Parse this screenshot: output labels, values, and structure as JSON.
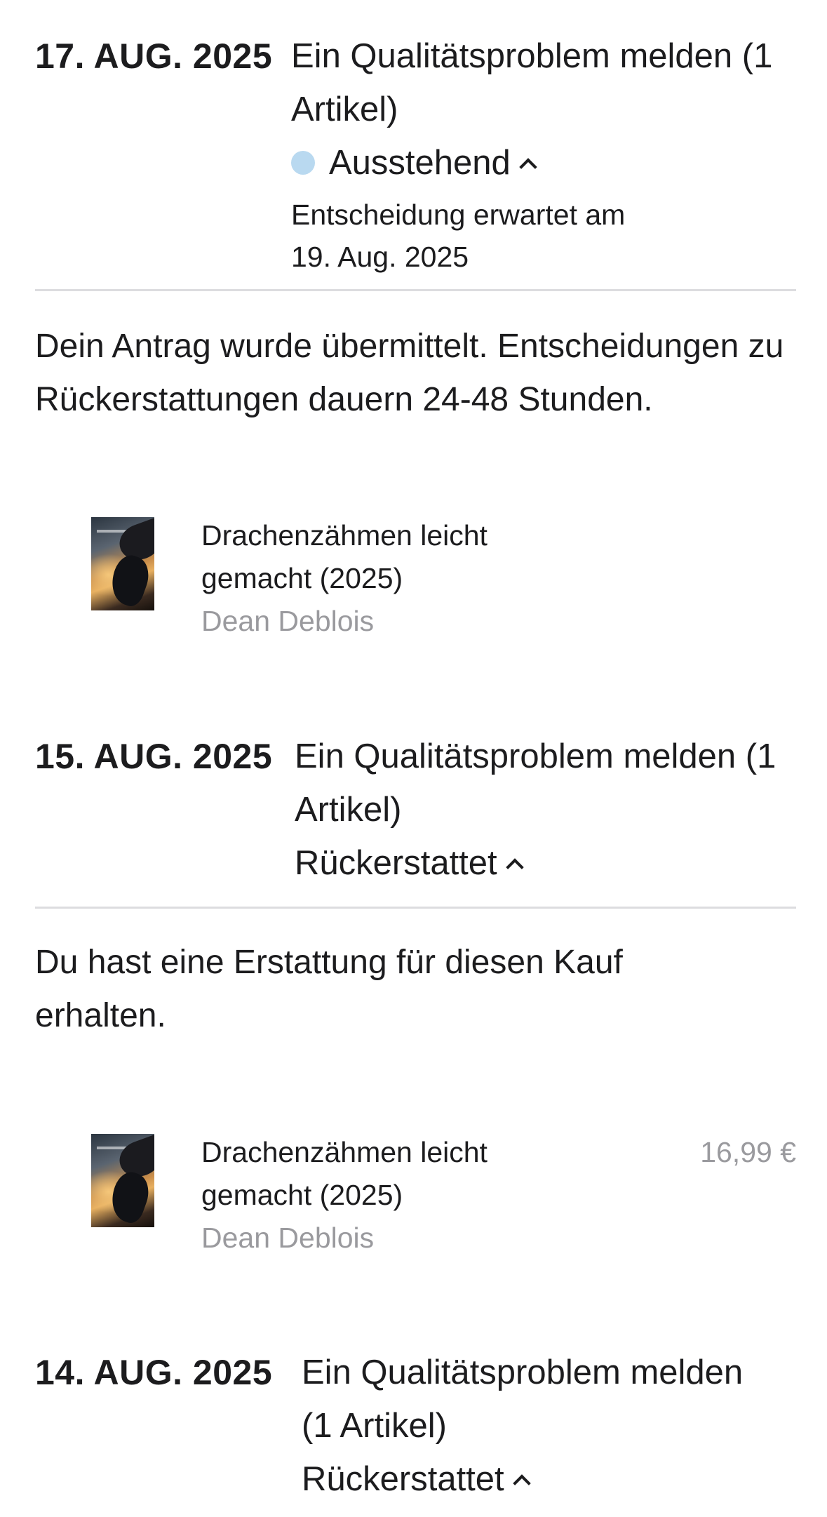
{
  "requests": [
    {
      "date": "17. AUG. 2025",
      "title": "Ein Qualitätsproblem melden (1 Artikel)",
      "status": "Ausstehend",
      "status_color": "#b9d9f0",
      "decision_line1": "Entscheidung erwartet am",
      "decision_line2": "19. Aug. 2025",
      "message": "Dein Antrag wurde übermittelt. Entscheidungen zu Rückerstattungen dauern 24-48 Stunden.",
      "item": {
        "title": "Drachenzähmen leicht gemacht (2025)",
        "artist": "Dean Deblois",
        "price": ""
      }
    },
    {
      "date": "15. AUG. 2025",
      "title": "Ein Qualitätsproblem melden (1 Artikel)",
      "status": "Rückerstattet",
      "message": "Du hast eine Erstattung für diesen Kauf erhalten.",
      "item": {
        "title": "Drachenzähmen leicht gemacht (2025)",
        "artist": "Dean Deblois",
        "price": "16,99 €"
      }
    },
    {
      "date": "14. AUG. 2025",
      "title": "Ein Qualitätsproblem melden (1 Artikel)",
      "status": "Rückerstattet"
    }
  ],
  "icons": {
    "expand": "chevron-up-icon",
    "status_dot": "status-dot-icon",
    "artwork": "movie-artwork"
  }
}
